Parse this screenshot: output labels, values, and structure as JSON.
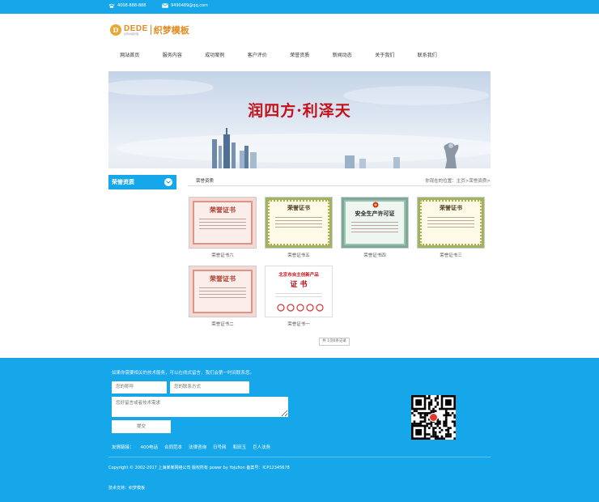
{
  "topbar": {
    "phone_icon": "phone-icon",
    "phone": "4008-888-888",
    "mail_icon": "mail-icon",
    "email": "9490489@qq.com"
  },
  "logo": {
    "badge": "D",
    "brand": "DEDE",
    "brand_sub": "织梦内容管理",
    "name": "织梦模板"
  },
  "nav": {
    "items": [
      "网站首页",
      "服务内容",
      "成功案例",
      "客户评价",
      "荣誉资质",
      "新闻动态",
      "关于我们",
      "联系我们"
    ]
  },
  "banner": {
    "title": "润四方·利泽天"
  },
  "sidebar": {
    "title": "荣誉资质",
    "toggle_icon": "chevron-down-icon"
  },
  "content": {
    "section_title": "荣誉资质",
    "breadcrumb": "你现在的位置：主页>荣誉资质>"
  },
  "certificates": [
    {
      "caption": "荣誉证书六",
      "heading": "荣誉证书"
    },
    {
      "caption": "荣誉证书五",
      "heading": "荣誉证书"
    },
    {
      "caption": "荣誉证书四",
      "heading": "安全生产许可证"
    },
    {
      "caption": "荣誉证书三",
      "heading": "荣誉证书"
    },
    {
      "caption": "荣誉证书二",
      "heading": "荣誉证书"
    },
    {
      "caption": "荣誉证书一",
      "heading": "北京市自主创新产品",
      "heading2": "证 书"
    }
  ],
  "pager": {
    "text": "共 1页6条记录"
  },
  "footer": {
    "intro": "如果你需要相关的技术服务，可以在线式留言，我们会第一时间联系您。",
    "name_placeholder": "您的称呼",
    "contact_placeholder": "您的联系方式",
    "message_placeholder": "您好留言或者技术需求",
    "submit": "提交",
    "links_label": "友情链接：",
    "links": [
      "400电话",
      "合同范本",
      "法律咨询",
      "日号网",
      "和田玉",
      "巨人法务"
    ],
    "copyright": "Copyright © 2002-2017 上海某某网络公司 版权所有 power by Yojufion  备案号：ICP12345678",
    "tech_support": "技术支持：织梦模板",
    "qr_icon": "qr-code-icon"
  },
  "colors": {
    "brand_blue": "#16a6ea",
    "logo_orange": "#e28a1f",
    "banner_red": "#c3111a"
  }
}
